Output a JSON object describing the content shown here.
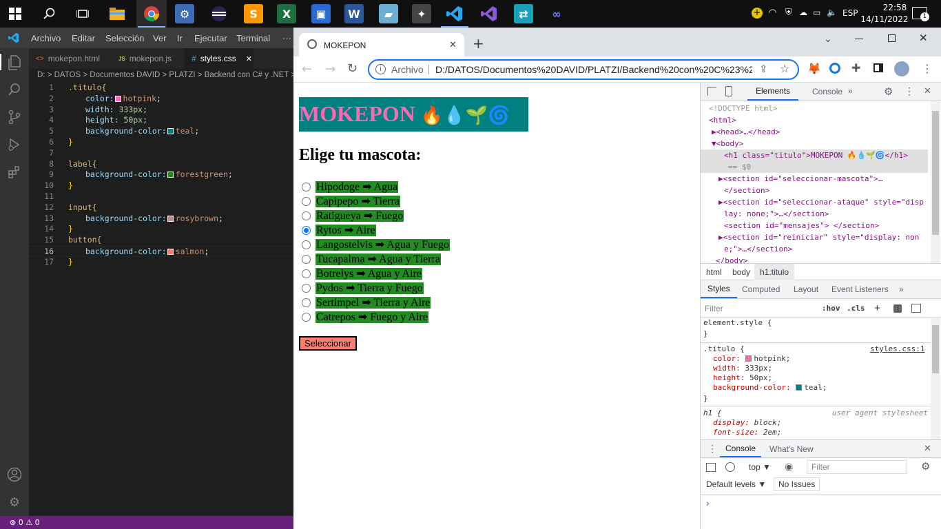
{
  "taskbar": {
    "apps": [
      "start",
      "search",
      "task-view",
      "file-explorer",
      "chrome",
      "app-gear",
      "eclipse",
      "sublime-text",
      "excel",
      "app-monitor",
      "word",
      "app-notes",
      "app-games",
      "vscode",
      "visual-studio",
      "app-network",
      "app-infinity"
    ],
    "tray": {
      "language": "ESP",
      "time": "22:58",
      "date": "14/11/2022",
      "notification_count": "1"
    }
  },
  "vscode": {
    "menu": [
      "Archivo",
      "Editar",
      "Selección",
      "Ver",
      "Ir",
      "Ejecutar",
      "Terminal",
      "···"
    ],
    "tabs": [
      {
        "icon": "<>",
        "label": "mokepon.html"
      },
      {
        "icon": "JS",
        "label": "mokepon.js"
      },
      {
        "icon": "#",
        "label": "styles.css",
        "close": "✕"
      }
    ],
    "breadcrumb": "D: > DATOS > Documentos DAVID > PLATZI > Backend con C# y .NET > Nuev",
    "code_lines": [
      {
        "n": "1",
        "sel": ".titulo{"
      },
      {
        "n": "2",
        "prop": "color:",
        "swatch": "#ff69b4",
        "val": "hotpink",
        "end": ";"
      },
      {
        "n": "3",
        "prop": "width:",
        "num": "333px",
        "end": ";"
      },
      {
        "n": "4",
        "prop": "height:",
        "num": "50px",
        "end": ";"
      },
      {
        "n": "5",
        "prop": "background-color:",
        "swatch": "#008080",
        "val": "teal",
        "end": ";"
      },
      {
        "n": "6",
        "brace": "}"
      },
      {
        "n": "7"
      },
      {
        "n": "8",
        "sel": "label{"
      },
      {
        "n": "9",
        "prop": "background-color:",
        "swatch": "#228b22",
        "val": "forestgreen",
        "end": ";"
      },
      {
        "n": "10",
        "brace": "}"
      },
      {
        "n": "11"
      },
      {
        "n": "12",
        "sel": "input{"
      },
      {
        "n": "13",
        "prop": "background-color:",
        "swatch": "#bc8f8f",
        "val": "rosybrown",
        "end": ";"
      },
      {
        "n": "14",
        "brace": "}"
      },
      {
        "n": "15",
        "sel": "button{"
      },
      {
        "n": "16",
        "prop": "background-color:",
        "swatch": "#fa8072",
        "val": "salmon",
        "end": ";"
      },
      {
        "n": "17",
        "brace": "}"
      }
    ],
    "status": "⊗ 0 ⚠ 0"
  },
  "chrome": {
    "tab_title": "MOKEPON",
    "address_prefix": "Archivo",
    "address": "D:/DATOS/Documentos%20DAVID/PLATZI/Backend%20con%20C%23%2...",
    "page": {
      "title": "MOKEPON",
      "title_emojis": "🔥💧🌱🌀",
      "subtitle": "Elige tu mascota:",
      "pets": [
        {
          "label": "Hipodoge ➡ Agua",
          "checked": false
        },
        {
          "label": "Capipepo ➡ Tierra",
          "checked": false
        },
        {
          "label": "Ratigueya ➡ Fuego",
          "checked": false
        },
        {
          "label": "Rytos ➡ Aire",
          "checked": true
        },
        {
          "label": "Langostelvis ➡ Agua y Fuego",
          "checked": false
        },
        {
          "label": "Tucapalma ➡ Agua y Tierra",
          "checked": false
        },
        {
          "label": "Botrelys ➡ Agua y Aire",
          "checked": false
        },
        {
          "label": "Pydos ➡ Tierra y Fuego",
          "checked": false
        },
        {
          "label": "Sertimpel ➡ Tierra y Aire",
          "checked": false
        },
        {
          "label": "Catrepos ➡ Fuego y Aire",
          "checked": false
        }
      ],
      "button": "Seleccionar"
    },
    "devtools": {
      "tabs": [
        "Elements",
        "Console"
      ],
      "dom": [
        {
          "text": "<!DOCTYPE html>"
        },
        {
          "text": "<html>"
        },
        {
          "text": "▶<head>…</head>"
        },
        {
          "text": "▼<body>"
        },
        {
          "text": "<h1 class=\"titulo\">MOKEPON 🔥💧🌱🌀</h1>"
        },
        {
          "text": "== $0"
        },
        {
          "text": "▶<section id=\"seleccionar-mascota\">…"
        },
        {
          "text": "</section>"
        },
        {
          "text": "▶<section id=\"seleccionar-ataque\" style=\"disp"
        },
        {
          "text": "lay: none;\">…</section>"
        },
        {
          "text": "<section id=\"mensajes\"> </section>"
        },
        {
          "text": "▶<section id=\"reiniciar\" style=\"display: non"
        },
        {
          "text": "e;\">…</section>"
        },
        {
          "text": "</body>"
        }
      ],
      "crumbs": [
        "html",
        "body",
        "h1.titulo"
      ],
      "style_tabs": [
        "Styles",
        "Computed",
        "Layout",
        "Event Listeners",
        "»"
      ],
      "filter_placeholder": "Filter",
      "hov": ":hov",
      "cls": ".cls",
      "element_style": "element.style {",
      "close_brace": "}",
      "rule_selector": ".titulo {",
      "rule_source": "styles.css:1",
      "rule_props": [
        {
          "p": "color:",
          "swatch": "#ff69b4",
          "v": "hotpink;"
        },
        {
          "p": "width:",
          "v": "333px;"
        },
        {
          "p": "height:",
          "v": "50px;"
        },
        {
          "p": "background-color:",
          "swatch": "#008080",
          "v": "teal;"
        }
      ],
      "ua_selector": "h1 {",
      "ua_label": "user agent stylesheet",
      "ua_props": [
        {
          "p": "display:",
          "v": "block;"
        },
        {
          "p": "font-size:",
          "v": "2em;"
        }
      ],
      "drawer_tabs": [
        "Console",
        "What's New"
      ],
      "console_context": "top ▼",
      "console_filter": "Filter",
      "default_levels": "Default levels ▼",
      "no_issues": "No Issues",
      "prompt": "›"
    }
  }
}
